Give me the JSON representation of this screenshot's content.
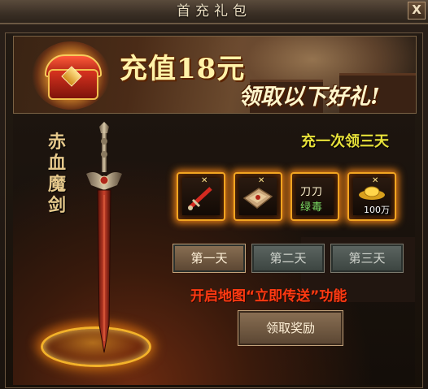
{
  "window": {
    "title": "首充礼包",
    "close_label": "X"
  },
  "banner": {
    "recharge_text": "充值18元",
    "gift_text": "领取以下好礼!"
  },
  "sword": {
    "name": "赤血魔剑"
  },
  "rewards": {
    "headline": "充一次领三天",
    "items": [
      {
        "icon": "red-sword-icon",
        "count": ""
      },
      {
        "icon": "scroll-book-icon",
        "count": ""
      },
      {
        "icon": "daggers-poison-icon",
        "line1": "刀刀",
        "line2": "绿毒",
        "count": ""
      },
      {
        "icon": "gold-ingot-icon",
        "count": "100万"
      }
    ]
  },
  "days": [
    {
      "label": "第一天",
      "active": true
    },
    {
      "label": "第二天",
      "active": false
    },
    {
      "label": "第三天",
      "active": false
    }
  ],
  "feature_text": "开启地图“立即传送”功能",
  "claim_label": "领取奖励"
}
